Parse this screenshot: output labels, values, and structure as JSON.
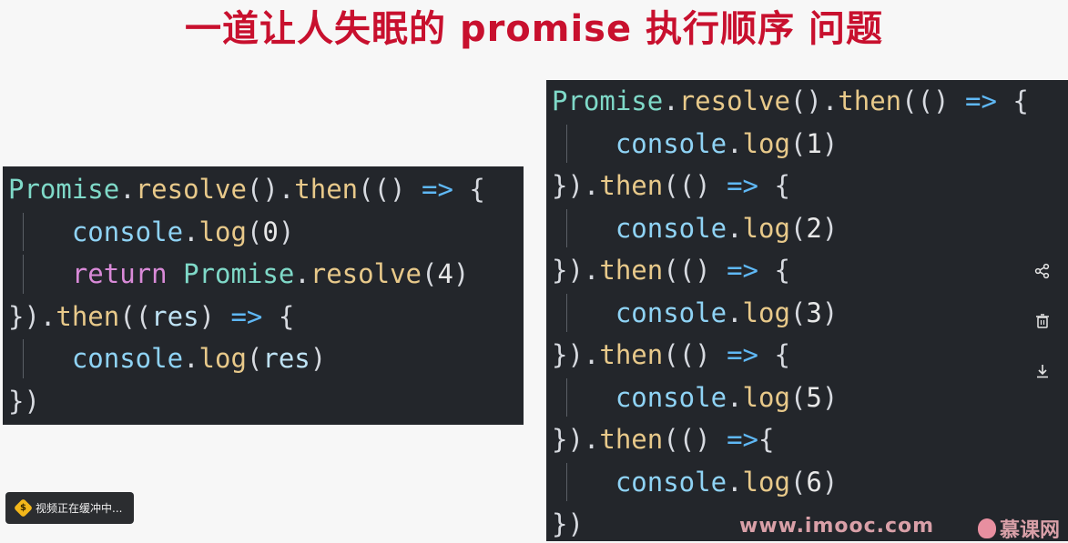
{
  "title": "一道让人失眠的 promise 执行顺序 问题",
  "left_code": {
    "lines": [
      [
        [
          "cls",
          "Promise"
        ],
        [
          "p",
          "."
        ],
        [
          "fn",
          "resolve"
        ],
        [
          "p",
          "()."
        ],
        [
          "fn",
          "then"
        ],
        [
          "p",
          "(() "
        ],
        [
          "arrow",
          "=>"
        ],
        [
          "p",
          " {"
        ]
      ],
      [
        [
          "p",
          "    "
        ],
        [
          "con",
          "console"
        ],
        [
          "p",
          "."
        ],
        [
          "fn",
          "log"
        ],
        [
          "p",
          "("
        ],
        [
          "num",
          "0"
        ],
        [
          "p",
          ")"
        ]
      ],
      [
        [
          "p",
          "    "
        ],
        [
          "kw",
          "return"
        ],
        [
          "p",
          " "
        ],
        [
          "cls",
          "Promise"
        ],
        [
          "p",
          "."
        ],
        [
          "fn",
          "resolve"
        ],
        [
          "p",
          "("
        ],
        [
          "num",
          "4"
        ],
        [
          "p",
          ")"
        ]
      ],
      [
        [
          "p",
          "})."
        ],
        [
          "fn",
          "then"
        ],
        [
          "p",
          "(("
        ],
        [
          "id",
          "res"
        ],
        [
          "p",
          ") "
        ],
        [
          "arrow",
          "=>"
        ],
        [
          "p",
          " {"
        ]
      ],
      [
        [
          "p",
          "    "
        ],
        [
          "con",
          "console"
        ],
        [
          "p",
          "."
        ],
        [
          "fn",
          "log"
        ],
        [
          "p",
          "("
        ],
        [
          "id",
          "res"
        ],
        [
          "p",
          ")"
        ]
      ],
      [
        [
          "p",
          "})"
        ]
      ]
    ]
  },
  "right_code": {
    "lines": [
      [
        [
          "cls",
          "Promise"
        ],
        [
          "p",
          "."
        ],
        [
          "fn",
          "resolve"
        ],
        [
          "p",
          "()."
        ],
        [
          "fn",
          "then"
        ],
        [
          "p",
          "(() "
        ],
        [
          "arrow",
          "=>"
        ],
        [
          "p",
          " {"
        ]
      ],
      [
        [
          "p",
          "    "
        ],
        [
          "con",
          "console"
        ],
        [
          "p",
          "."
        ],
        [
          "fn",
          "log"
        ],
        [
          "p",
          "("
        ],
        [
          "num",
          "1"
        ],
        [
          "p",
          ")"
        ]
      ],
      [
        [
          "p",
          "})."
        ],
        [
          "fn",
          "then"
        ],
        [
          "p",
          "(() "
        ],
        [
          "arrow",
          "=>"
        ],
        [
          "p",
          " {"
        ]
      ],
      [
        [
          "p",
          "    "
        ],
        [
          "con",
          "console"
        ],
        [
          "p",
          "."
        ],
        [
          "fn",
          "log"
        ],
        [
          "p",
          "("
        ],
        [
          "num",
          "2"
        ],
        [
          "p",
          ")"
        ]
      ],
      [
        [
          "p",
          "})."
        ],
        [
          "fn",
          "then"
        ],
        [
          "p",
          "(() "
        ],
        [
          "arrow",
          "=>"
        ],
        [
          "p",
          " {"
        ]
      ],
      [
        [
          "p",
          "    "
        ],
        [
          "con",
          "console"
        ],
        [
          "p",
          "."
        ],
        [
          "fn",
          "log"
        ],
        [
          "p",
          "("
        ],
        [
          "num",
          "3"
        ],
        [
          "p",
          ")"
        ]
      ],
      [
        [
          "p",
          "})."
        ],
        [
          "fn",
          "then"
        ],
        [
          "p",
          "(() "
        ],
        [
          "arrow",
          "=>"
        ],
        [
          "p",
          " {"
        ]
      ],
      [
        [
          "p",
          "    "
        ],
        [
          "con",
          "console"
        ],
        [
          "p",
          "."
        ],
        [
          "fn",
          "log"
        ],
        [
          "p",
          "("
        ],
        [
          "num",
          "5"
        ],
        [
          "p",
          ")"
        ]
      ],
      [
        [
          "p",
          "})."
        ],
        [
          "fn",
          "then"
        ],
        [
          "p",
          "(() "
        ],
        [
          "arrow",
          "=>"
        ],
        [
          "p",
          "{"
        ]
      ],
      [
        [
          "p",
          "    "
        ],
        [
          "con",
          "console"
        ],
        [
          "p",
          "."
        ],
        [
          "fn",
          "log"
        ],
        [
          "p",
          "("
        ],
        [
          "num",
          "6"
        ],
        [
          "p",
          ")"
        ]
      ],
      [
        [
          "p",
          "})"
        ]
      ]
    ]
  },
  "side_icons": [
    {
      "name": "share-icon",
      "glyph": "⋰"
    },
    {
      "name": "trash-icon",
      "glyph": "🗑"
    },
    {
      "name": "download-icon",
      "glyph": "⤓"
    }
  ],
  "toast": {
    "icon": "$",
    "text": "视频正在缓冲中..."
  },
  "watermark": {
    "site": "www.imooc.com",
    "brand": "慕课网"
  },
  "colors": {
    "title": "#c8102e",
    "editor_bg": "#23262b"
  }
}
